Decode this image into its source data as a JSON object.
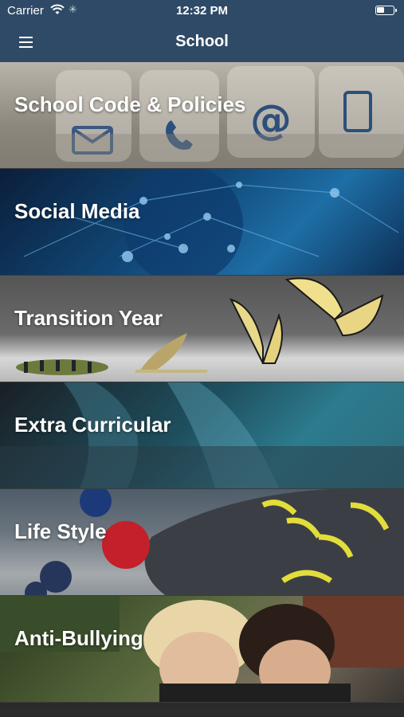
{
  "status_bar": {
    "carrier": "Carrier",
    "time": "12:32 PM"
  },
  "nav": {
    "title": "School",
    "menu_icon": "hamburger-menu-icon"
  },
  "items": [
    {
      "label": "School Code & Policies",
      "image": "contact-blocks-envelope-phone-at-mobile"
    },
    {
      "label": "Social Media",
      "image": "network-nodes-globe"
    },
    {
      "label": "Transition Year",
      "image": "caterpillar-chrysalis-butterflies"
    },
    {
      "label": "Extra Curricular",
      "image": "blurred-motion-teal"
    },
    {
      "label": "Life Style",
      "image": "berries-and-running-shoe"
    },
    {
      "label": "Anti-Bullying",
      "image": "two-girls-whispering"
    }
  ]
}
